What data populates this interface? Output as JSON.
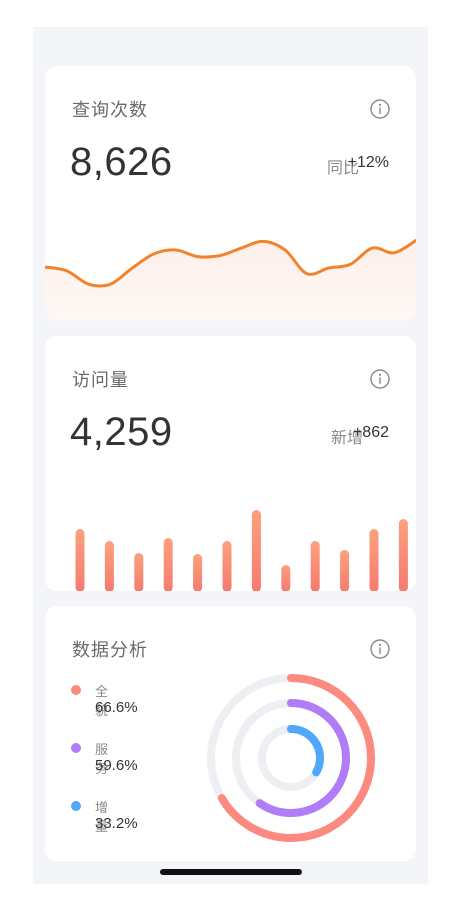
{
  "cards": {
    "queries": {
      "title": "查询次数",
      "value": "8,626",
      "compare_label": "同比",
      "compare_value": "+12%",
      "trend_series": [
        0.41,
        0.37,
        0.23,
        0.23,
        0.4,
        0.55,
        0.59,
        0.52,
        0.53,
        0.61,
        0.68,
        0.59,
        0.34,
        0.4,
        0.44,
        0.61,
        0.56,
        0.69
      ],
      "line_color": "#f2832c"
    },
    "visits": {
      "title": "访问量",
      "value": "4,259",
      "new_label": "新增",
      "new_value": "+862",
      "bars": [
        0.63,
        0.51,
        0.39,
        0.54,
        0.38,
        0.51,
        0.82,
        0.27,
        0.51,
        0.42,
        0.63,
        0.73
      ],
      "bar_color_top": "#fca17d",
      "bar_color_bottom": "#f67a6f"
    },
    "analysis": {
      "title": "数据分析",
      "items": [
        {
          "name": "全貌",
          "pct": "66.6%",
          "value": 0.666,
          "color": "#fd8a7f"
        },
        {
          "name": "服务",
          "pct": "59.6%",
          "value": 0.596,
          "color": "#b07cf7"
        },
        {
          "name": "增量",
          "pct": "33.2%",
          "value": 0.332,
          "color": "#51a7fb"
        }
      ],
      "track_color": "#eeeff2"
    }
  },
  "icons": {
    "info": "info-circle-icon"
  }
}
